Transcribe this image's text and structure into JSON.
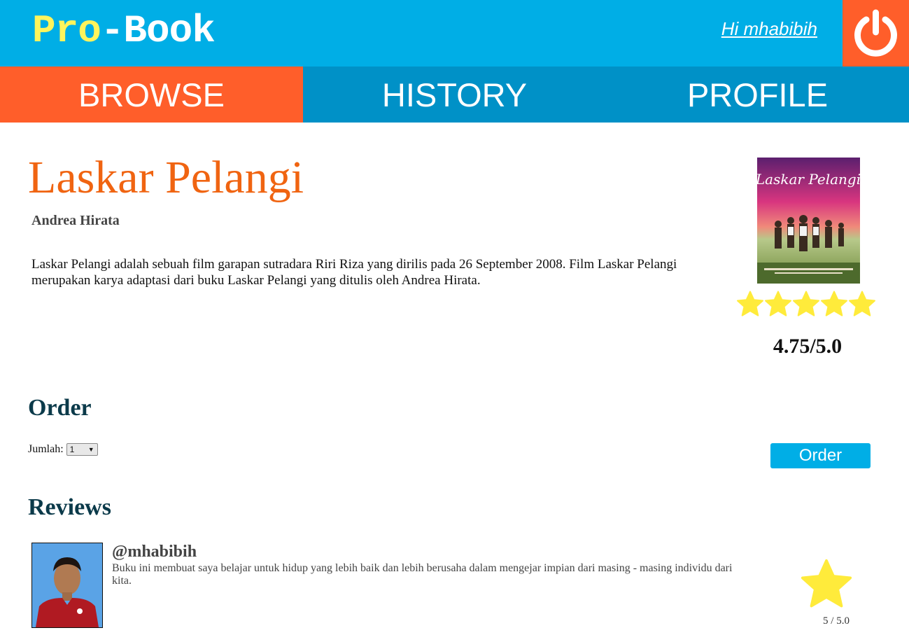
{
  "header": {
    "logo_part1": "Pro",
    "logo_part2": "-Book",
    "greeting": "Hi mhabibih",
    "logout_icon": "power-icon"
  },
  "nav": {
    "items": [
      {
        "label": "BROWSE",
        "active": true
      },
      {
        "label": "HISTORY",
        "active": false
      },
      {
        "label": "PROFILE",
        "active": false
      }
    ]
  },
  "book": {
    "title": "Laskar Pelangi",
    "author": "Andrea Hirata",
    "description": "Laskar Pelangi adalah sebuah film garapan sutradara Riri Riza yang dirilis pada 26 September 2008. Film Laskar Pelangi merupakan karya adaptasi dari buku Laskar Pelangi yang ditulis oleh Andrea Hirata.",
    "cover_title_art": "Laskar Pelangi",
    "rating_stars": 5,
    "score": "4.75/5.0"
  },
  "order": {
    "heading": "Order",
    "quantity_label": "Jumlah:",
    "quantity_value": "1",
    "button_label": "Order"
  },
  "reviews": {
    "heading": "Reviews",
    "items": [
      {
        "username": "@mhabibih",
        "text": "Buku ini membuat saya belajar untuk hidup yang lebih baik dan lebih berusaha dalam mengejar impian dari masing - masing individu dari kita.",
        "stars": 1,
        "score": "5 / 5.0"
      }
    ]
  },
  "colors": {
    "header_blue": "#00aee6",
    "nav_blue": "#0091c7",
    "accent_orange": "#ff5e2a",
    "title_orange": "#f06411",
    "logo_yellow": "#fff45c",
    "star_yellow": "#ffeb3b"
  }
}
